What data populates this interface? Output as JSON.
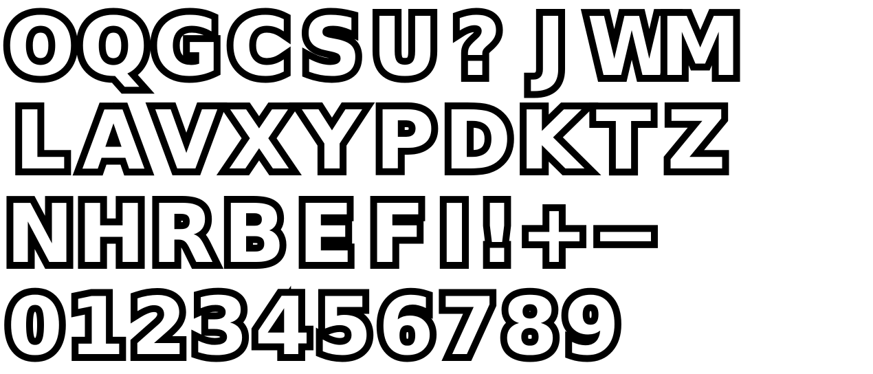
{
  "glyph_sheet": {
    "rows": [
      [
        "O",
        "Q",
        "G",
        "C",
        "S",
        "U",
        "?",
        "J",
        "W",
        "M"
      ],
      [
        "L",
        "A",
        "V",
        "X",
        "Y",
        "P",
        "D",
        "K",
        "T",
        "Z"
      ],
      [
        "N",
        "H",
        "R",
        "B",
        "E",
        "F",
        "I",
        "!",
        "+",
        "−"
      ],
      [
        "0",
        "1",
        "2",
        "3",
        "4",
        "5",
        "6",
        "7",
        "8",
        "9"
      ]
    ],
    "colors": {
      "fill": "#ffffff",
      "outline": "#000000",
      "background": "#ffffff"
    }
  }
}
